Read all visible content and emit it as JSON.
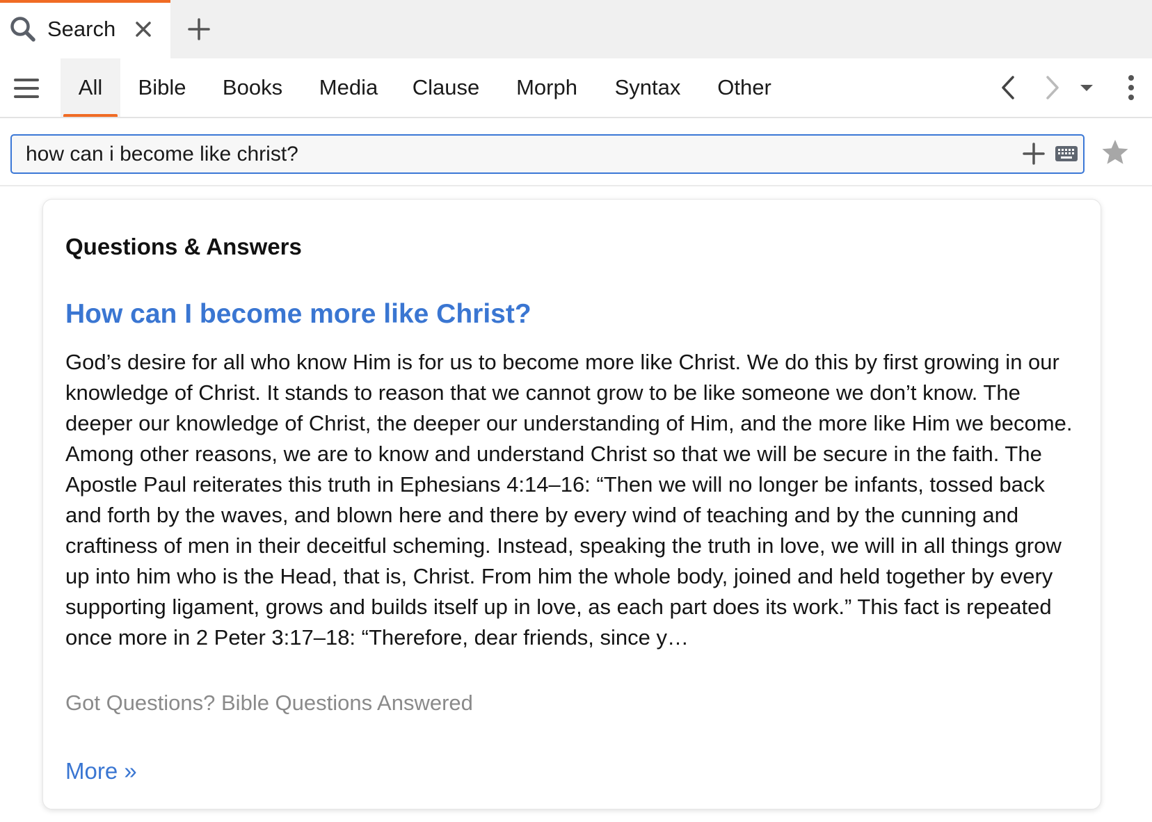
{
  "tab": {
    "title": "Search",
    "icon": "search-icon",
    "close_icon": "close-icon",
    "new_tab_icon": "plus-icon"
  },
  "toolbar": {
    "menu_icon": "hamburger-menu-icon",
    "filters": [
      {
        "label": "All",
        "active": true
      },
      {
        "label": "Bible",
        "active": false
      },
      {
        "label": "Books",
        "active": false
      },
      {
        "label": "Media",
        "active": false
      },
      {
        "label": "Clause",
        "active": false
      },
      {
        "label": "Morph",
        "active": false
      },
      {
        "label": "Syntax",
        "active": false
      },
      {
        "label": "Other",
        "active": false
      }
    ],
    "back_icon": "chevron-left-icon",
    "forward_icon": "chevron-right-icon",
    "history_icon": "caret-down-icon",
    "more_icon": "more-vertical-icon"
  },
  "search": {
    "query": "how can i become like christ?",
    "add_icon": "plus-icon",
    "keyboard_icon": "keyboard-icon",
    "favorite_icon": "star-icon"
  },
  "result_card": {
    "heading": "Questions & Answers",
    "title": "How can I become more like Christ?",
    "body": "God’s desire for all who know Him is for us to become more like Christ. We do this by first growing in our knowledge of Christ. It stands to reason that we cannot grow to be like someone we don’t know. The deeper our knowledge of Christ, the deeper our understanding of Him, and the more like Him we become. Among other reasons, we are to know and understand Christ so that we will be secure in the faith. The Apostle Paul reiterates this truth in Ephesians 4:14–16: “Then we will no longer be infants, tossed back and forth by the waves, and blown here and there by every wind of teaching and by the cunning and craftiness of men in their deceitful scheming. Instead, speaking the truth in love, we will in all things grow up into him who is the Head, that is, Christ. From him the whole body, joined and held together by every supporting ligament, grows and builds itself up in love, as each part does its work.” This fact is repeated once more in 2 Peter 3:17–18: “Therefore, dear friends, since y…",
    "source": "Got Questions? Bible Questions Answered",
    "more_label": "More »"
  },
  "colors": {
    "accent_orange": "#f06b24",
    "link_blue": "#3a76d2",
    "focus_blue": "#3b78d6",
    "muted_gray": "#8a8a8a"
  }
}
